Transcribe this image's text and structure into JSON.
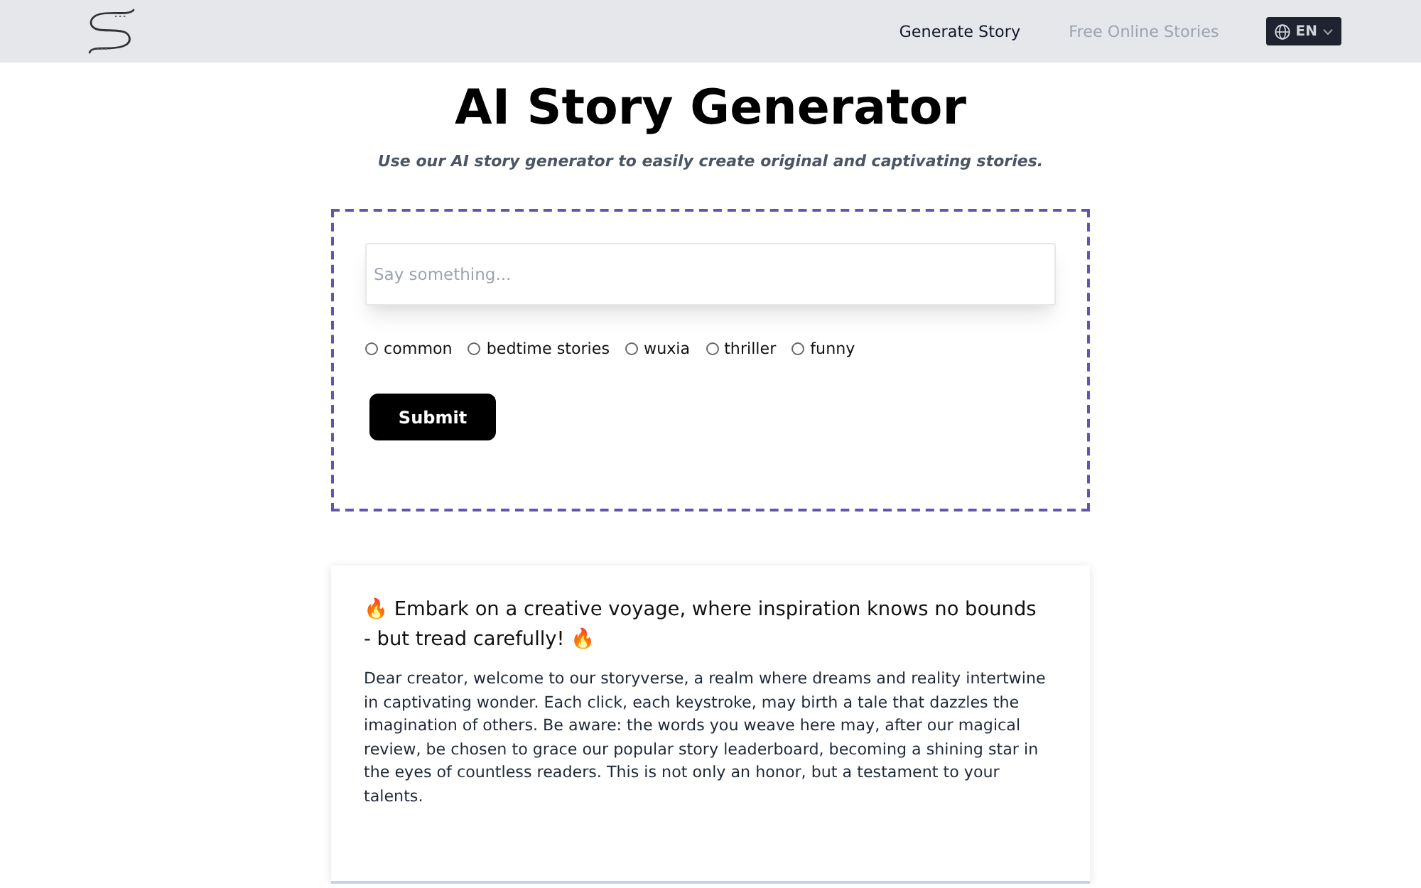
{
  "header": {
    "nav": [
      {
        "label": "Generate Story",
        "selected": true
      },
      {
        "label": "Free Online Stories",
        "selected": false
      }
    ],
    "language": {
      "label": "EN"
    }
  },
  "hero": {
    "title": "AI Story Generator",
    "subtitle": "Use our AI story generator to easily create original and captivating stories."
  },
  "form": {
    "input": {
      "placeholder": "Say something..."
    },
    "genres": [
      {
        "label": "common",
        "selected": false
      },
      {
        "label": "bedtime stories",
        "selected": false
      },
      {
        "label": "wuxia",
        "selected": false
      },
      {
        "label": "thriller",
        "selected": false
      },
      {
        "label": "funny",
        "selected": false
      }
    ],
    "submit": "Submit"
  },
  "notice": {
    "heading": "🔥 Embark on a creative voyage, where inspiration knows no bounds - but tread carefully! 🔥",
    "body": "Dear creator, welcome to our storyverse, a realm where dreams and reality intertwine in captivating wonder. Each click, each keystroke, may birth a tale that dazzles the imagination of others. Be aware: the words you weave here may, after our magical review, be chosen to grace our popular story leaderboard, becoming a shining star in the eyes of countless readers. This is not only an honor, but a testament to your talents."
  }
}
